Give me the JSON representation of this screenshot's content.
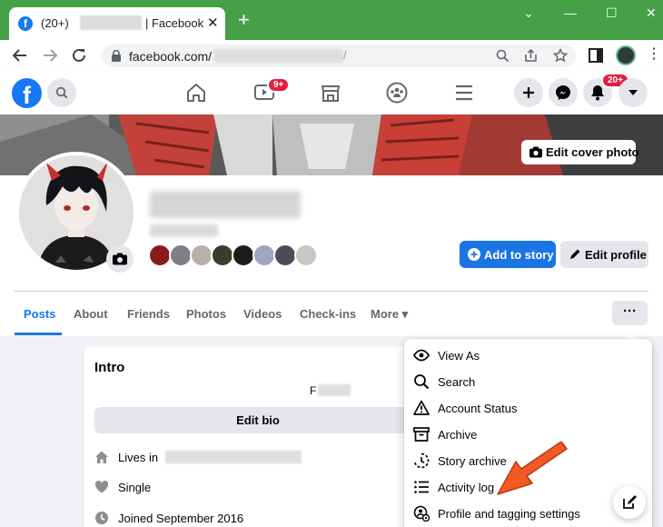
{
  "browser": {
    "tab": {
      "favicon_letter": "f",
      "count_text": "(20+)",
      "title_suffix": "| Facebook",
      "close_label": "✕"
    },
    "new_tab_label": "+",
    "window_controls": [
      "⌄",
      "—",
      "☐",
      "✕"
    ],
    "address": {
      "url_text": "facebook.com/",
      "trailing": "/"
    }
  },
  "header": {
    "logo_letter": "f",
    "watch_badge": "9+",
    "notifications_badge": "20+"
  },
  "cover": {
    "edit_cover_label": "Edit cover photo"
  },
  "profile": {
    "add_story_label": "Add to story",
    "edit_profile_label": "Edit profile"
  },
  "tabs": [
    {
      "label": "Posts"
    },
    {
      "label": "About"
    },
    {
      "label": "Friends"
    },
    {
      "label": "Photos"
    },
    {
      "label": "Videos"
    },
    {
      "label": "Check-ins"
    },
    {
      "label": "More ▾"
    }
  ],
  "more_dots": "···",
  "intro": {
    "title": "Intro",
    "bio_initial": "F",
    "edit_bio_label": "Edit bio",
    "lives_in_label": "Lives in",
    "relationship": "Single",
    "joined": "Joined September 2016"
  },
  "menu": {
    "items": [
      {
        "label": "View As",
        "icon": "eye-icon"
      },
      {
        "label": "Search",
        "icon": "search-icon"
      },
      {
        "label": "Account Status",
        "icon": "warning-icon"
      },
      {
        "label": "Archive",
        "icon": "archive-box-icon"
      },
      {
        "label": "Story archive",
        "icon": "story-archive-icon"
      },
      {
        "label": "Activity log",
        "icon": "list-icon"
      },
      {
        "label": "Profile and tagging settings",
        "icon": "profile-settings-icon"
      }
    ]
  },
  "colors": {
    "browser_frame": "#45a047",
    "facebook_blue": "#1877f2",
    "badge_red": "#e41e3f",
    "arrow_orange": "#f15a22"
  }
}
